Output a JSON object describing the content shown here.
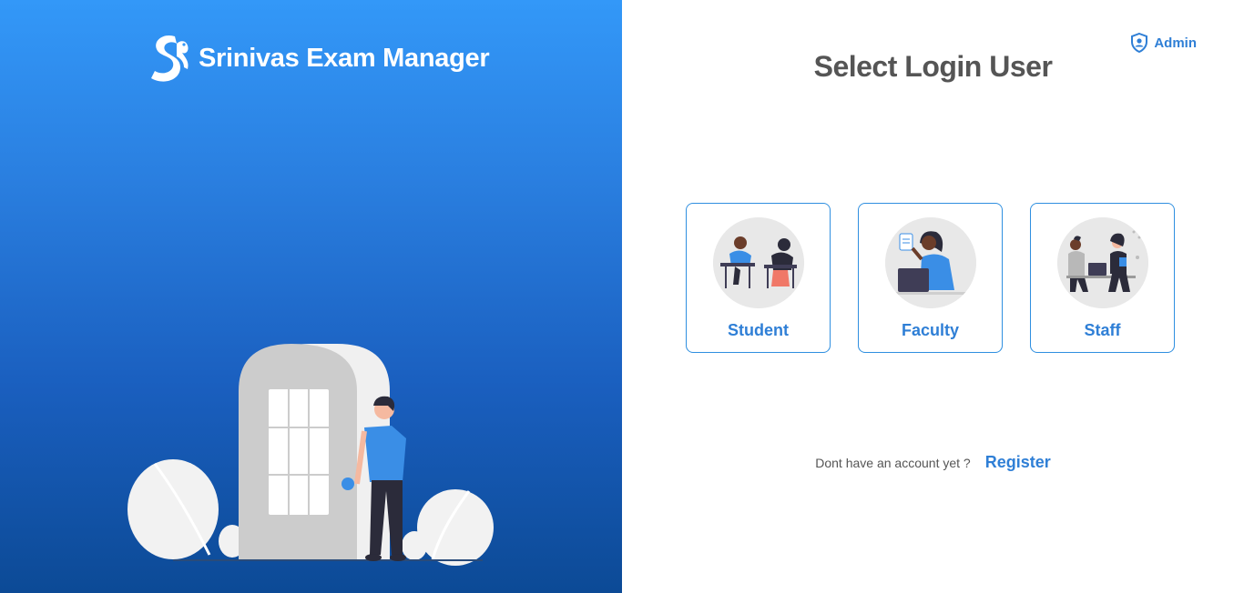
{
  "brand": {
    "name": "Srinivas Exam Manager",
    "logo_icon": "srinivas-logo-icon"
  },
  "header": {
    "admin_label": "Admin",
    "admin_icon": "shield-user-icon"
  },
  "main": {
    "title": "Select Login User",
    "roles": [
      {
        "label": "Student",
        "icon": "students-at-desks-illustration"
      },
      {
        "label": "Faculty",
        "icon": "faculty-at-laptop-illustration"
      },
      {
        "label": "Staff",
        "icon": "staff-meeting-illustration"
      }
    ]
  },
  "footer": {
    "prompt": "Dont have an account yet ?",
    "register_label": "Register"
  },
  "colors": {
    "accent": "#2f7fd6",
    "left_gradient_top": "#3398f8",
    "left_gradient_bottom": "#0c4a96",
    "title_gray": "#555555",
    "card_border": "#2f8fe0"
  }
}
